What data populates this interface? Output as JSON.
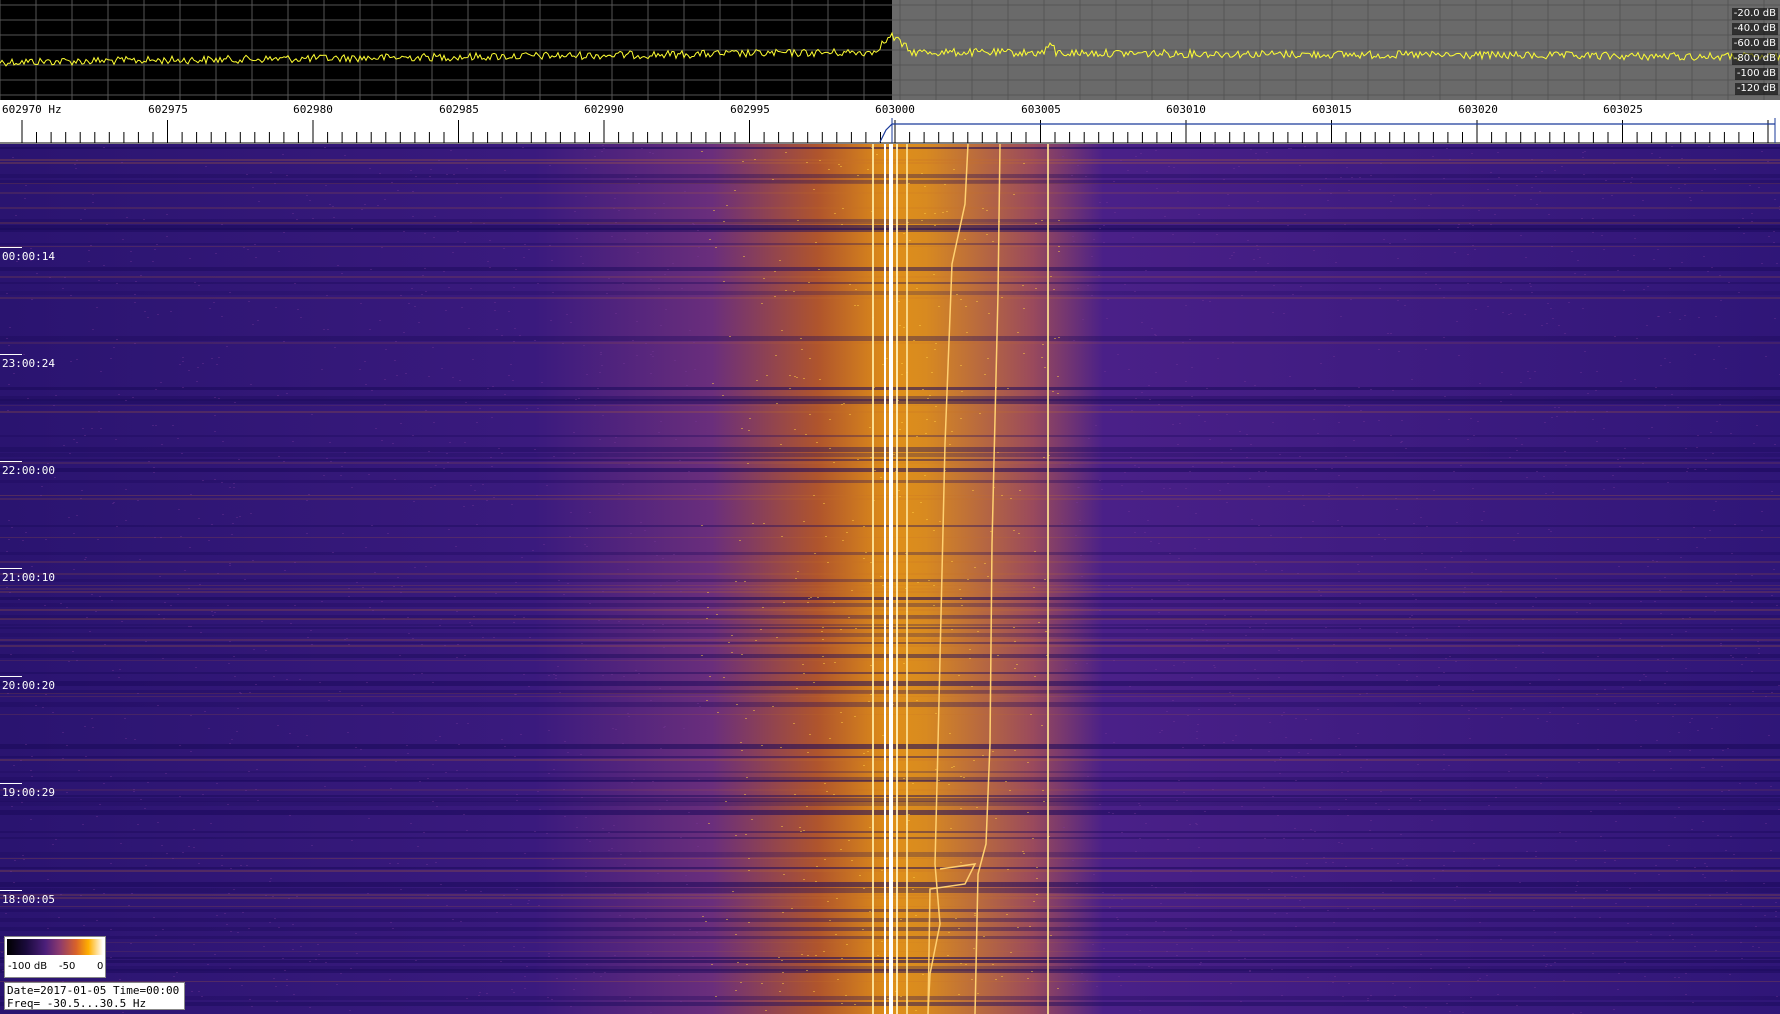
{
  "spectrum": {
    "db_labels": [
      "-20.0 dB",
      "-40.0 dB",
      "-60.0 dB",
      "-80.0 dB",
      "-100 dB",
      "-120 dB"
    ],
    "trace_color": "#ffff33",
    "grid_color": "#555555",
    "left_bg": "#000000",
    "right_bg": "#6a6a6a"
  },
  "frequency_axis": {
    "labels": [
      "602970 Hz",
      "602975",
      "602980",
      "602985",
      "602990",
      "602995",
      "603000",
      "603005",
      "603010",
      "603015",
      "603020",
      "603025"
    ]
  },
  "waterfall": {
    "time_labels": [
      "00:00:14",
      "23:00:24",
      "22:00:00",
      "21:00:10",
      "20:00:20",
      "19:00:29",
      "18:00:05"
    ],
    "palette": [
      "#2a1470",
      "#4b1f8a",
      "#8a3a6e",
      "#d9742a",
      "#ffb000",
      "#ffffff"
    ]
  },
  "colorbar": {
    "labels": [
      "-100 dB",
      "-50",
      "0"
    ]
  },
  "info": {
    "line1": "Date=2017-01-05 Time=00:00",
    "line2": "Freq= -30.5...30.5 Hz"
  }
}
